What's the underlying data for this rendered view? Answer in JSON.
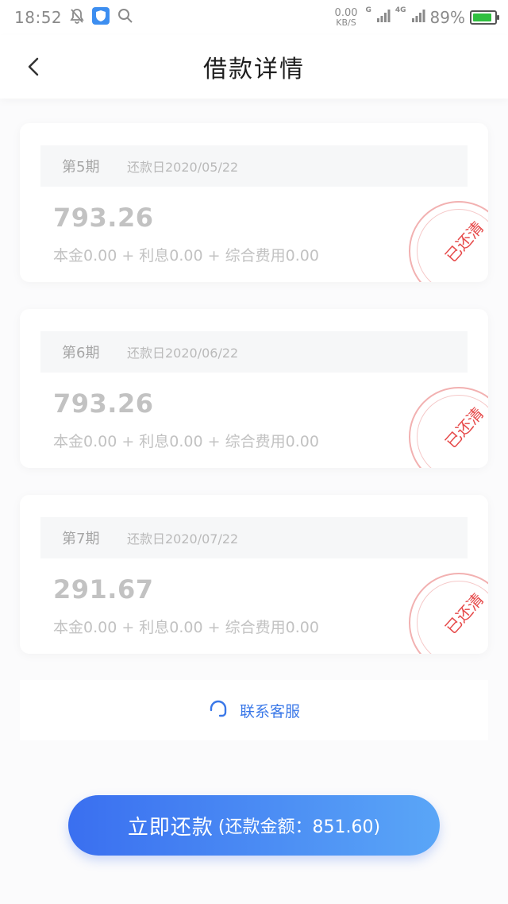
{
  "status_bar": {
    "time": "18:52",
    "speed_value": "0.00",
    "speed_unit": "KB/S",
    "net1": "G",
    "net2": "4G",
    "battery": "89%",
    "battery_level": 0.89
  },
  "header": {
    "title": "借款详情"
  },
  "installments": [
    {
      "period": "第5期",
      "due_date": "还款日2020/05/22",
      "amount": "793.26",
      "breakdown": "本金0.00 + 利息0.00 + 综合费用0.00",
      "stamp": "已还清"
    },
    {
      "period": "第6期",
      "due_date": "还款日2020/06/22",
      "amount": "793.26",
      "breakdown": "本金0.00 + 利息0.00 + 综合费用0.00",
      "stamp": "已还清"
    },
    {
      "period": "第7期",
      "due_date": "还款日2020/07/22",
      "amount": "291.67",
      "breakdown": "本金0.00 + 利息0.00 + 综合费用0.00",
      "stamp": "已还清"
    }
  ],
  "contact": {
    "label": "联系客服",
    "icon": "headset-icon"
  },
  "pay_button": {
    "label": "立即还款",
    "amount_text": "(还款金额：851.60)"
  },
  "colors": {
    "accent": "#3a78e8",
    "button_start": "#3a6ff0",
    "button_end": "#5aa6f7",
    "stamp_red": "#e64a4a"
  }
}
